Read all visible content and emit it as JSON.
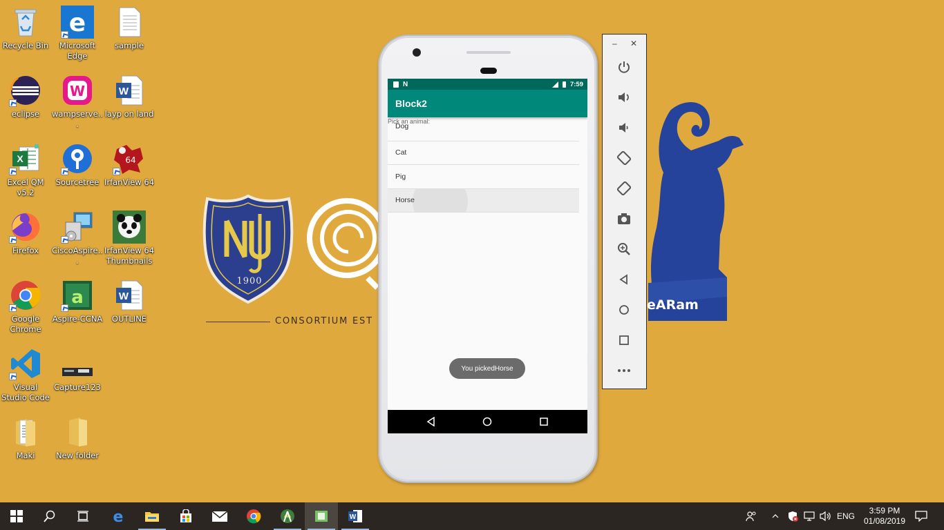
{
  "desktop": {
    "icons": [
      {
        "label": "Recycle Bin"
      },
      {
        "label": "Microsoft Edge"
      },
      {
        "label": "sample"
      },
      {
        "label": "eclipse"
      },
      {
        "label": "wampserve..."
      },
      {
        "label": "layp on land"
      },
      {
        "label": "Excel QM v5.2"
      },
      {
        "label": "Sourcetree"
      },
      {
        "label": "IrfanView 64"
      },
      {
        "label": "Firefox"
      },
      {
        "label": "CiscoAspire..."
      },
      {
        "label": "IrfanView 64 Thumbnails"
      },
      {
        "label": "Google Chrome"
      },
      {
        "label": "Aspire-CCNA"
      },
      {
        "label": "OUTLINE"
      },
      {
        "label": "Visual Studio Code"
      },
      {
        "label": "Capture123"
      },
      {
        "label": "Maki"
      },
      {
        "label": "New folder"
      }
    ]
  },
  "wallpaper": {
    "crest_year": "1900",
    "consortium_text": "CONSORTIUM EST",
    "ram_text": "eARam"
  },
  "emulator": {
    "status_time": "7:59",
    "app_title": "Block2",
    "prompt": "Pick an animal:",
    "list_items": [
      "Dog",
      "Cat",
      "Pig",
      "Horse"
    ],
    "pressed_item": "Horse",
    "toast": "You pickedHorse"
  },
  "taskbar": {
    "language": "ENG",
    "time": "3:59 PM",
    "date": "01/08/2019"
  },
  "colors": {
    "desktop_bg": "#dfa93e",
    "status_bar": "#00675b",
    "app_bar": "#00897b",
    "toast": "#6b6b6b",
    "taskbar": "#2b2621"
  }
}
